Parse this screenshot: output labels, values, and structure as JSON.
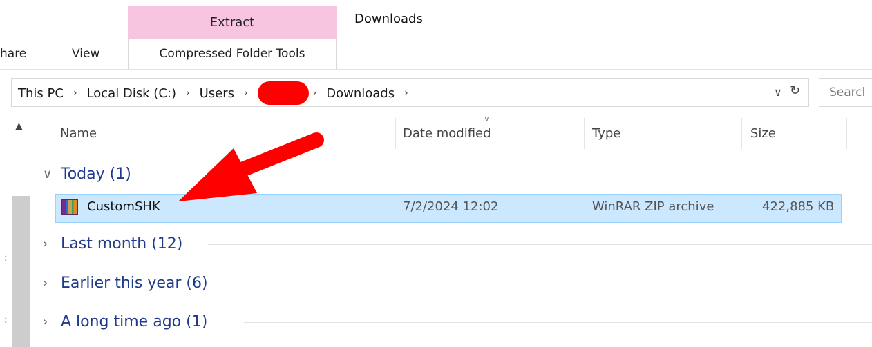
{
  "ribbon": {
    "contextual_header": "Extract",
    "contextual_tab": "Compressed Folder Tools",
    "window_title": "Downloads",
    "tabs": [
      "hare",
      "View"
    ]
  },
  "address_bar": {
    "crumbs": [
      "This PC",
      "Local Disk (C:)",
      "Users",
      "Downloads"
    ],
    "search_placeholder": "Searcl"
  },
  "columns": {
    "name": "Name",
    "date_modified": "Date modified",
    "type": "Type",
    "size": "Size"
  },
  "groups": [
    {
      "label": "Today (1)",
      "expanded": true
    },
    {
      "label": "Last month (12)",
      "expanded": false
    },
    {
      "label": "Earlier this year (6)",
      "expanded": false
    },
    {
      "label": "A long time ago (1)",
      "expanded": false
    }
  ],
  "files": [
    {
      "name": "CustomSHK",
      "date": "7/2/2024 12:02",
      "type": "WinRAR ZIP archive",
      "size": "422,885 KB",
      "selected": true,
      "icon": "winrar-archive-icon"
    }
  ],
  "colors": {
    "contextual_tab": "#f7c5df",
    "selection": "#cce8ff",
    "group_text": "#1e3a8a",
    "annotation": "#ff0000"
  }
}
